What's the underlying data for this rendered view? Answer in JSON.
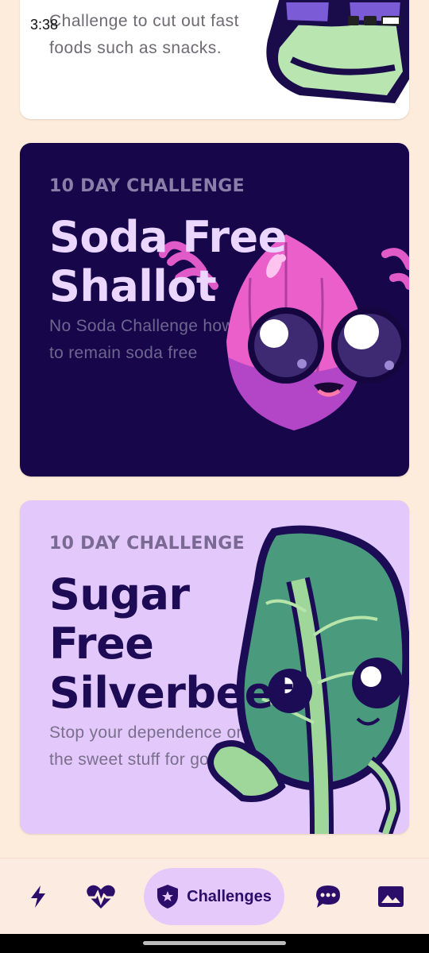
{
  "status": {
    "time": "3:38"
  },
  "cards": [
    {
      "description": "Challenge to cut out fast foods such as snacks."
    },
    {
      "kicker": "10 DAY CHALLENGE",
      "title": "Soda Free Shallot",
      "description": "No Soda Challenge how to remain soda free"
    },
    {
      "kicker": "10 DAY CHALLENGE",
      "title": "Sugar Free Silverbeet",
      "description": "Stop your dependence on the sweet stuff for good"
    }
  ],
  "nav": {
    "items": [
      {
        "icon": "bolt-icon"
      },
      {
        "icon": "heart-pulse-icon"
      },
      {
        "icon": "shield-star-icon",
        "label": "Challenges",
        "active": true
      },
      {
        "icon": "chat-icon"
      },
      {
        "icon": "image-icon"
      }
    ]
  },
  "colors": {
    "background": "#fdebdc",
    "soda_card": "#17074a",
    "sugar_card": "#e2c8fb",
    "accent": "#2a0e6a"
  }
}
